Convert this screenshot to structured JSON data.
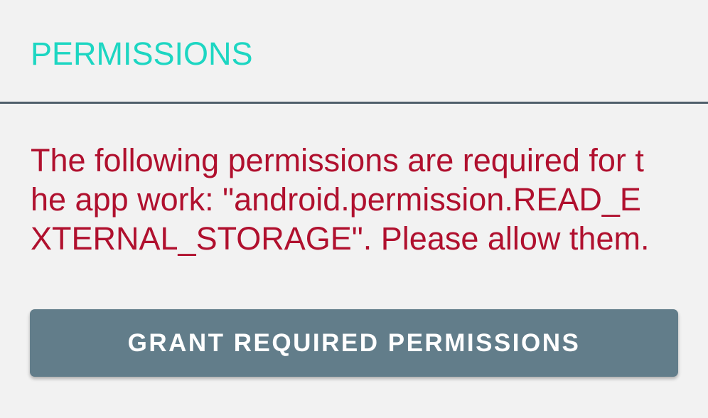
{
  "section": {
    "title": "PERMISSIONS"
  },
  "message": {
    "text": "The following permissions are required for the app work: \"android.permission.READ_EXTERNAL_STORAGE\". Please allow them."
  },
  "button": {
    "label": "GRANT REQUIRED PERMISSIONS"
  },
  "colors": {
    "title": "#1dd6c2",
    "message": "#b0102e",
    "button_bg": "#627d8a",
    "divider": "#4f5f6b",
    "background": "#f2f2f2"
  }
}
